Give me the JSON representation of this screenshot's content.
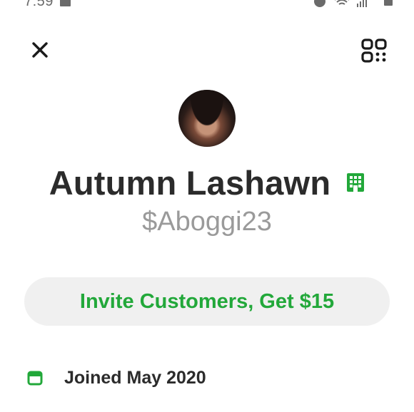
{
  "status_bar": {
    "time": "7:59",
    "icons": [
      "notification-icon",
      "alarm-icon",
      "wifi-icon",
      "signal-icon",
      "battery-icon"
    ]
  },
  "header": {
    "close_icon": "close-icon",
    "qr_icon": "qr-code-icon"
  },
  "profile": {
    "display_name": "Autumn Lashawn",
    "cashtag": "$Aboggi23",
    "badge_icon": "business-building-icon"
  },
  "invite": {
    "label": "Invite Customers, Get $15"
  },
  "details": {
    "joined_icon": "calendar-icon",
    "joined_text": "Joined May 2020"
  },
  "colors": {
    "accent_green": "#22a83a",
    "button_bg": "#f0f0f0",
    "text_dark": "#2b2b2b",
    "text_muted": "#9a9a9a"
  }
}
